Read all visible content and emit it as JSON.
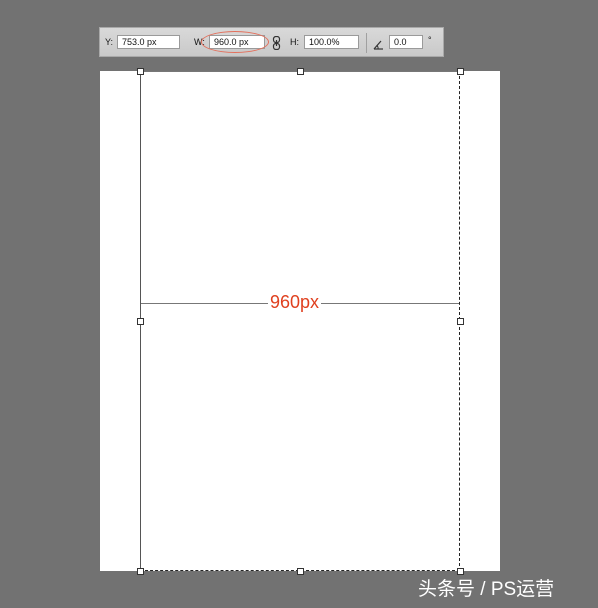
{
  "options_bar": {
    "y_label": "Y:",
    "y_value": "753.0 px",
    "w_label": "W:",
    "w_value": "960.0 px",
    "h_label": "H:",
    "h_value": "100.0%",
    "angle_value": "0.0",
    "degree_symbol": "°",
    "link_icon": "chain-link-icon",
    "angle_icon": "rotation-angle-icon",
    "highlight_color": "#e36f5b"
  },
  "canvas": {
    "measure_label": "960px",
    "measure_color": "#e0401f"
  },
  "watermark": {
    "text": "头条号 / PS运营"
  }
}
